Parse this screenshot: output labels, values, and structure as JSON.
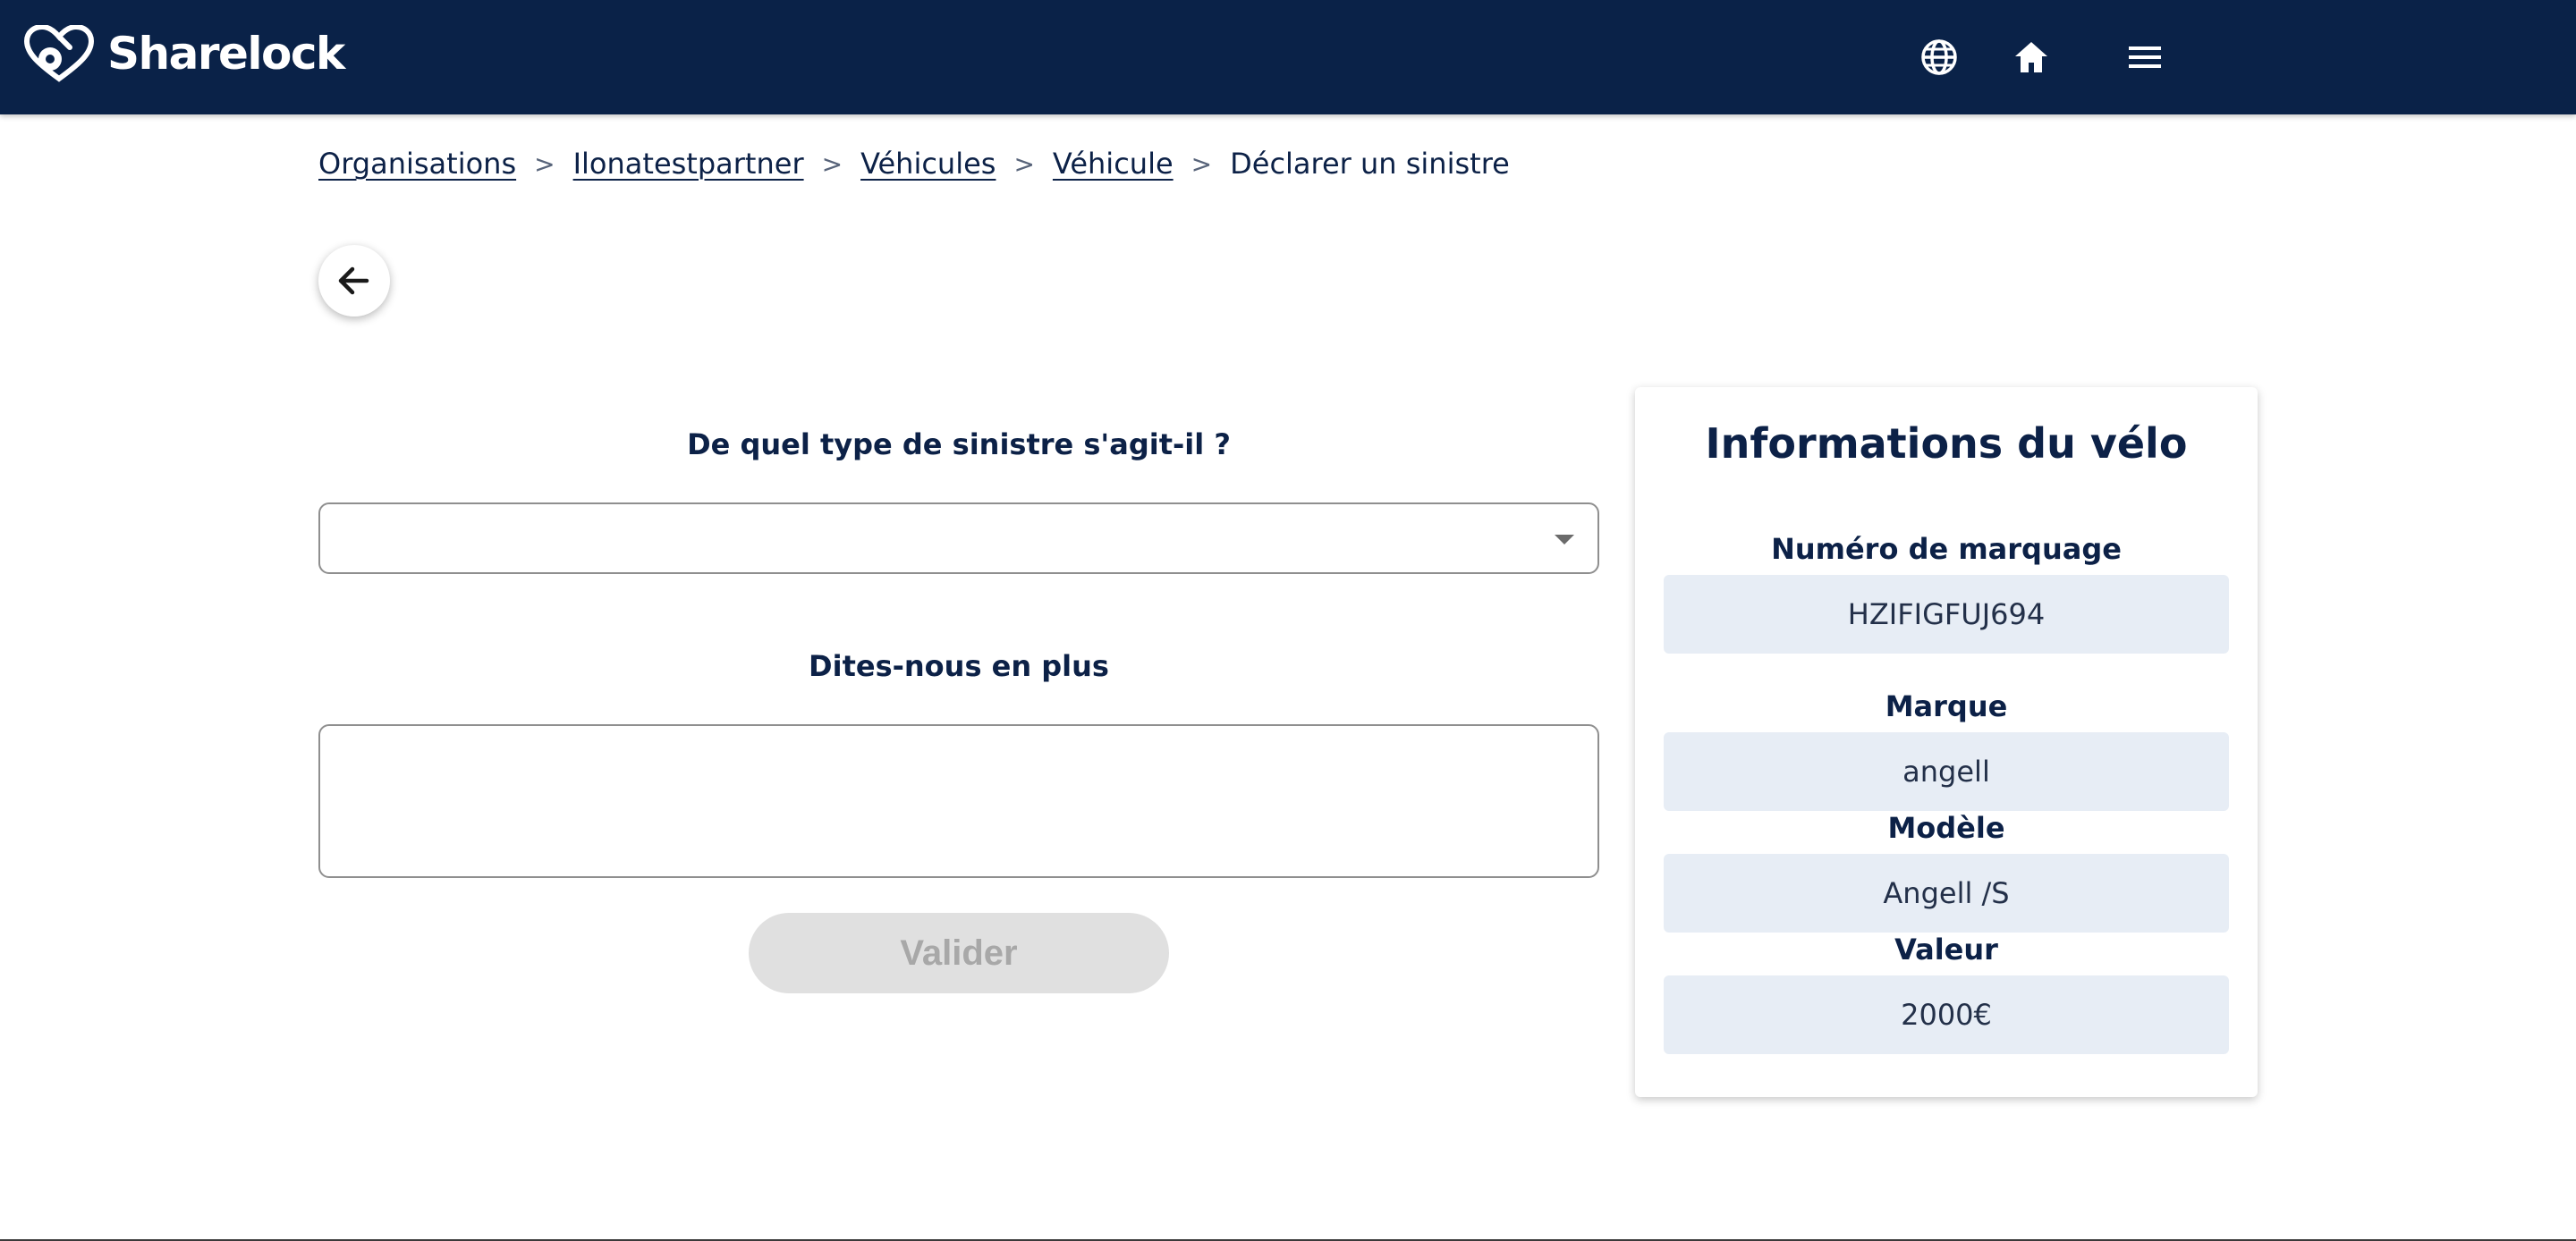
{
  "brand": {
    "name": "Sharelock",
    "header_color": "#0a2248"
  },
  "nav": {
    "icons": [
      "globe-icon",
      "home-icon",
      "menu-icon"
    ]
  },
  "breadcrumb": {
    "items": [
      "Organisations",
      "Ilonatestpartner",
      "Véhicules",
      "Véhicule"
    ],
    "separator": ">",
    "current": "Déclarer un sinistre"
  },
  "form": {
    "type_question": "De quel type de sinistre s'agit-il ?",
    "type_value": "",
    "details_question": "Dites-nous en plus",
    "details_value": "",
    "submit_label": "Valider"
  },
  "bike_info": {
    "title": "Informations du vélo",
    "fields": [
      {
        "label": "Numéro de marquage",
        "value": "HZIFIGFUJ694"
      },
      {
        "label": "Marque",
        "value": "angell"
      },
      {
        "label": "Modèle",
        "value": "Angell /S"
      },
      {
        "label": "Valeur",
        "value": "2000€"
      }
    ]
  }
}
